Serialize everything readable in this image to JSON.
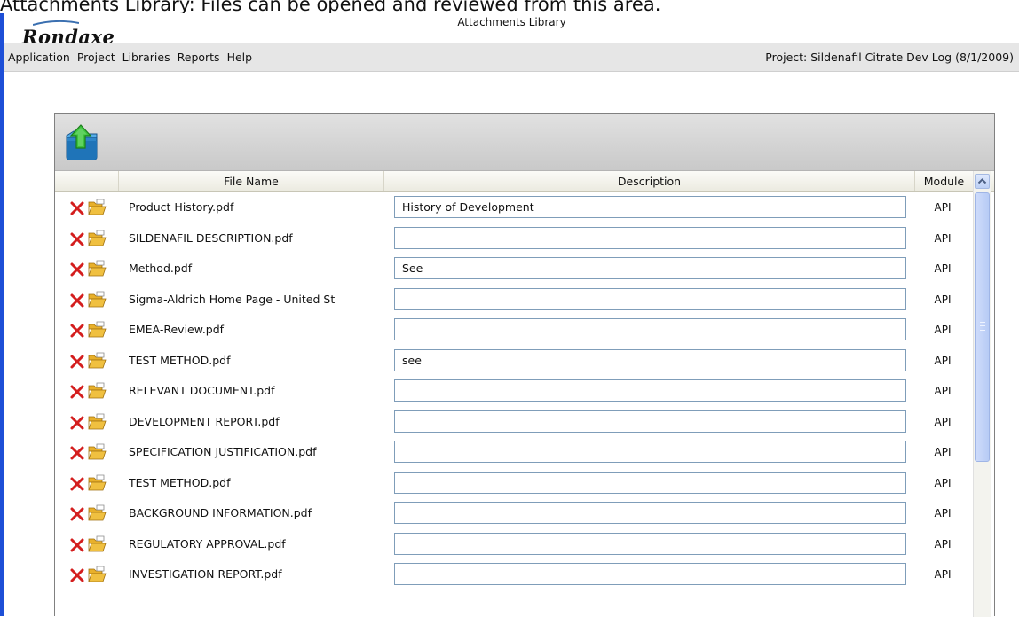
{
  "caption": "Attachments Library: Files can be opened and reviewed from this area.",
  "header": {
    "logo": "Rondaxe",
    "window_title": "Attachments Library"
  },
  "menu": {
    "items": [
      "Application",
      "Project",
      "Libraries",
      "Reports",
      "Help"
    ],
    "project_label": "Project: Sildenafil Citrate Dev Log (8/1/2009)"
  },
  "toolbar": {
    "upload_icon": "upload-folder-icon"
  },
  "table": {
    "columns": {
      "file_name": "File Name",
      "description": "Description",
      "module": "Module"
    },
    "rows": [
      {
        "file": "Product History.pdf",
        "description": "History of Development",
        "module": "API"
      },
      {
        "file": "SILDENAFIL DESCRIPTION.pdf",
        "description": "",
        "module": "API"
      },
      {
        "file": "Method.pdf",
        "description": "See",
        "module": "API"
      },
      {
        "file": "Sigma-Aldrich Home Page - United St",
        "description": "",
        "module": "API"
      },
      {
        "file": "EMEA-Review.pdf",
        "description": "",
        "module": "API"
      },
      {
        "file": "TEST METHOD.pdf",
        "description": "see",
        "module": "API"
      },
      {
        "file": "RELEVANT DOCUMENT.pdf",
        "description": "",
        "module": "API"
      },
      {
        "file": "DEVELOPMENT REPORT.pdf",
        "description": "",
        "module": "API"
      },
      {
        "file": "SPECIFICATION JUSTIFICATION.pdf",
        "description": "",
        "module": "API"
      },
      {
        "file": "TEST METHOD.pdf",
        "description": "",
        "module": "API"
      },
      {
        "file": "BACKGROUND INFORMATION.pdf",
        "description": "",
        "module": "API"
      },
      {
        "file": "REGULATORY APPROVAL.pdf",
        "description": "",
        "module": "API"
      },
      {
        "file": "INVESTIGATION REPORT.pdf",
        "description": "",
        "module": "API"
      }
    ]
  },
  "colors": {
    "accent_bar": "#1d4fd7",
    "delete_icon": "#d41e1e",
    "folder_icon": "#f0c040",
    "input_border": "#7f9db9"
  }
}
